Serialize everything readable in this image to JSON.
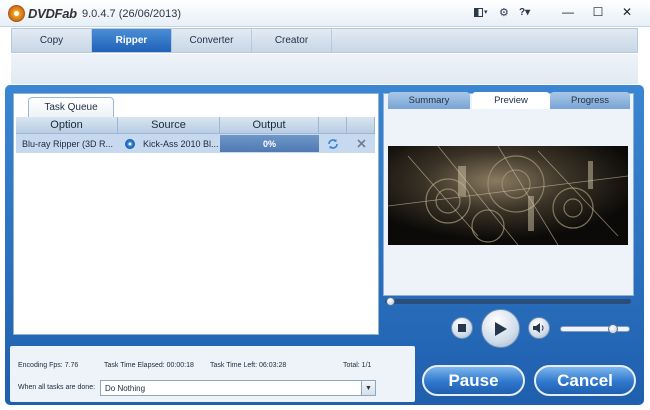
{
  "app": {
    "logo_text": "DVDFab",
    "version": "9.0.4.7 (26/06/2013)"
  },
  "title_controls": {
    "layout_label": "▾",
    "settings_label": "⚙",
    "help_label": "?▾",
    "minimize": "—",
    "maximize": "☐",
    "close": "✕"
  },
  "tabs": [
    {
      "label": "Copy",
      "active": false
    },
    {
      "label": "Ripper",
      "active": true
    },
    {
      "label": "Converter",
      "active": false
    },
    {
      "label": "Creator",
      "active": false
    }
  ],
  "queue": {
    "tab_label": "Task Queue",
    "columns": [
      "Option",
      "Source",
      "Output"
    ],
    "rows": [
      {
        "option": "Blu-ray Ripper (3D R...",
        "source": "Kick-Ass 2010 Bl...",
        "output": "0%"
      }
    ]
  },
  "right_tabs": [
    {
      "label": "Summary",
      "active": false
    },
    {
      "label": "Preview",
      "active": true
    },
    {
      "label": "Progress",
      "active": false
    }
  ],
  "status": {
    "fps": "Encoding Fps: 7.76",
    "elapsed": "Task Time Elapsed: 00:00:18",
    "left": "Task Time Left: 06:03:28",
    "total": "Total: 1/1"
  },
  "after_done": {
    "label": "When all tasks are done:",
    "value": "Do Nothing"
  },
  "buttons": {
    "pause": "Pause",
    "cancel": "Cancel"
  },
  "colors": {
    "accent": "#1f62b8",
    "frame": "#2f74c4"
  }
}
